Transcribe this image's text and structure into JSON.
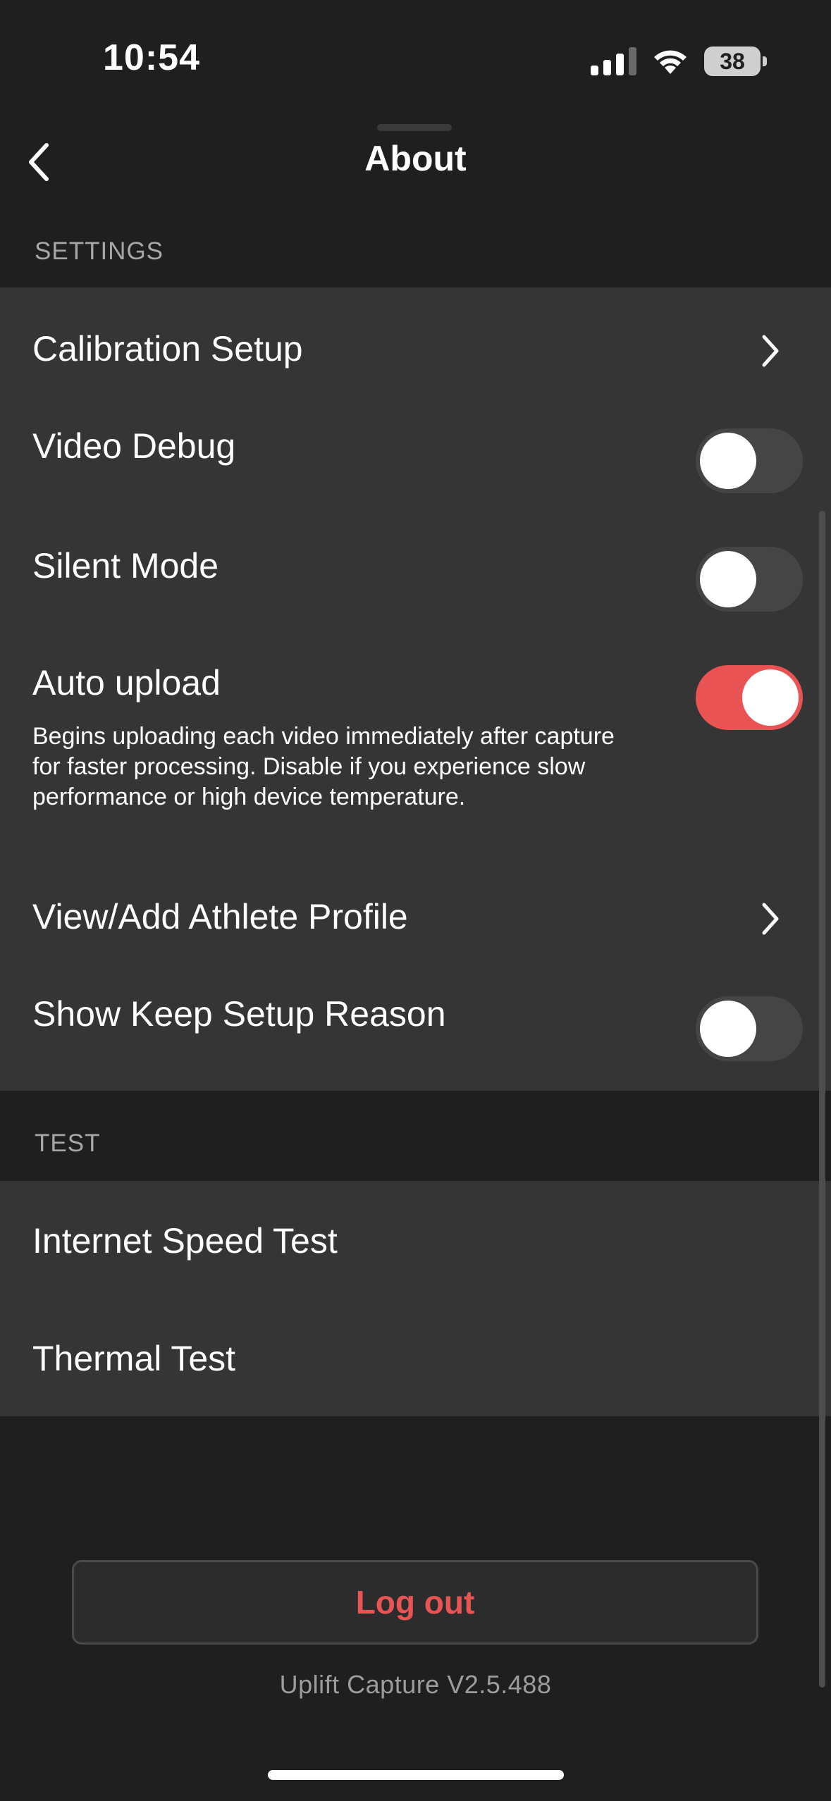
{
  "status_bar": {
    "time": "10:54",
    "battery": "38"
  },
  "header": {
    "title": "About",
    "back_icon": "chevron-left-icon"
  },
  "settings": {
    "section_label": "SETTINGS",
    "items": [
      {
        "label": "Calibration Setup",
        "control": "chevron"
      },
      {
        "label": "Video Debug",
        "control": "toggle",
        "on": false
      },
      {
        "label": "Silent Mode",
        "control": "toggle",
        "on": false
      },
      {
        "label": "Auto upload",
        "control": "toggle",
        "on": true,
        "description": "Begins uploading each video immediately after capture for faster processing. Disable if you experience slow performance or high device temperature."
      },
      {
        "label": "View/Add Athlete Profile",
        "control": "chevron"
      },
      {
        "label": "Show Keep Setup Reason",
        "control": "toggle",
        "on": false
      }
    ]
  },
  "test": {
    "section_label": "TEST",
    "items": [
      {
        "label": "Internet Speed Test"
      },
      {
        "label": "Thermal Test"
      }
    ]
  },
  "footer": {
    "logout_label": "Log out",
    "version": "Uplift Capture V2.5.488"
  },
  "colors": {
    "accent": "#e95353",
    "background": "#1f1f1f",
    "group_background": "#353535",
    "toggle_off": "#454545"
  }
}
